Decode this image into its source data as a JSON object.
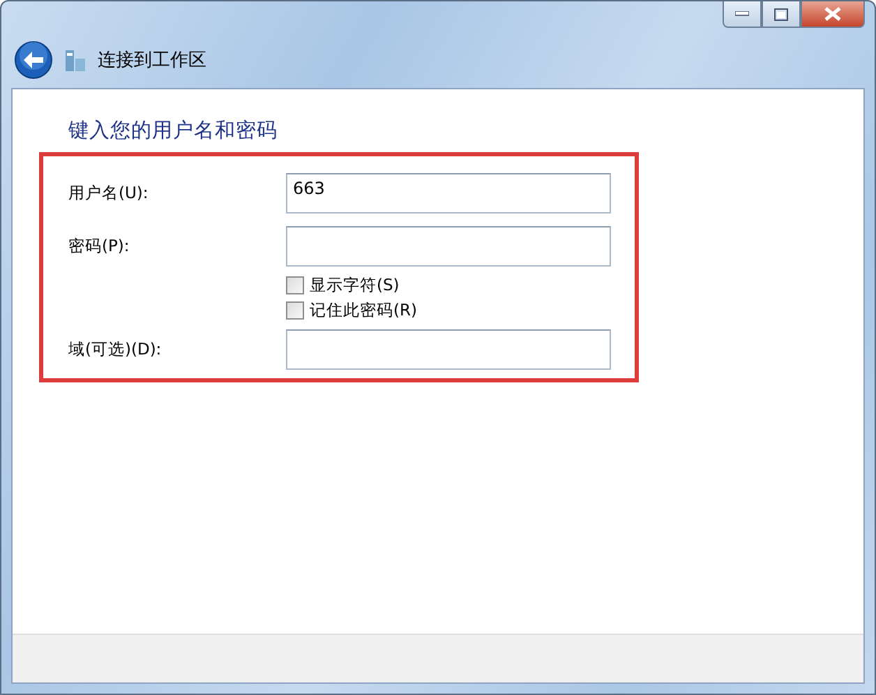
{
  "window": {
    "title": "连接到工作区"
  },
  "heading": "键入您的用户名和密码",
  "fields": [
    {
      "kind": "input",
      "label": "用户名(U):",
      "value": "663"
    },
    {
      "kind": "input",
      "label": "密码(P):"
    },
    {
      "kind": "checkbox",
      "label": "显示字符(S)",
      "checked": false
    },
    {
      "kind": "checkbox",
      "label": "记住此密码(R)",
      "checked": false
    },
    {
      "kind": "input",
      "label": "域(可选)(D):"
    }
  ]
}
